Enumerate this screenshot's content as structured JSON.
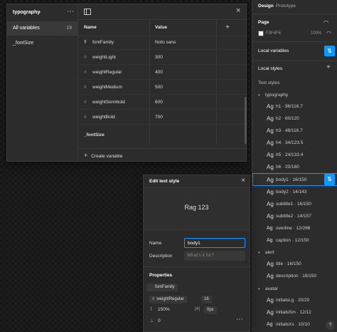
{
  "variables_modal": {
    "collection_title": "typography",
    "sidebar_items": [
      {
        "label": "All variables",
        "count": "19"
      },
      {
        "label": "_fontSize",
        "count": ""
      }
    ],
    "columns": {
      "name": "Name",
      "value": "Value"
    },
    "rows": [
      {
        "name": "fontFamily",
        "value": "Noto sans",
        "icon": "text-icon"
      },
      {
        "name": "weightLight",
        "value": "300",
        "icon": "number-icon"
      },
      {
        "name": "weightRegular",
        "value": "400",
        "icon": "number-icon"
      },
      {
        "name": "weightMedium",
        "value": "500",
        "icon": "number-icon"
      },
      {
        "name": "weightSemibold",
        "value": "600",
        "icon": "number-icon"
      },
      {
        "name": "weightBold",
        "value": "700",
        "icon": "number-icon"
      }
    ],
    "group_label": "_fontSize",
    "create_label": "Create variable"
  },
  "right_panel": {
    "tabs": [
      "Design",
      "Prototype"
    ],
    "page_section": "Page",
    "page_color": "F3F4F6",
    "page_opacity": "100%",
    "local_variables": "Local variables",
    "local_styles": "Local styles",
    "text_styles": "Text styles",
    "groups": {
      "typography": "typography",
      "alert": "alert",
      "avatar": "avatar"
    },
    "typography_styles": [
      {
        "ag": "Ag",
        "name": "h1",
        "spec": " · 96/116.7"
      },
      {
        "ag": "Ag",
        "name": "h2",
        "spec": " · 60/120"
      },
      {
        "ag": "Ag",
        "name": "h3",
        "spec": " · 48/116.7"
      },
      {
        "ag": "Ag",
        "name": "h4",
        "spec": " · 34/123.5"
      },
      {
        "ag": "Ag",
        "name": "h5",
        "spec": " · 24/133.4"
      },
      {
        "ag": "Ag",
        "name": "h6",
        "spec": " · 20/160"
      },
      {
        "ag": "Ag",
        "name": "body1",
        "spec": " · 16/150"
      },
      {
        "ag": "Ag",
        "name": "body2",
        "spec": " · 14/143"
      },
      {
        "ag": "Ag",
        "name": "subtitle1",
        "spec": " · 16/150"
      },
      {
        "ag": "Ag",
        "name": "subtitle2",
        "spec": " · 14/157"
      },
      {
        "ag": "Ag",
        "name": "overline",
        "spec": " · 12/266"
      },
      {
        "ag": "Ag",
        "name": "caption",
        "spec": " · 12/150"
      }
    ],
    "alert_styles": [
      {
        "ag": "Ag",
        "name": "title",
        "spec": " · 16/150"
      },
      {
        "ag": "Ag",
        "name": "description",
        "spec": " · 16/150"
      }
    ],
    "avatar_styles": [
      {
        "ag": "Ag",
        "name": "initialsLg",
        "spec": " · 20/20"
      },
      {
        "ag": "Ag",
        "name": "initialsSm",
        "spec": " · 12/12"
      },
      {
        "ag": "Ag",
        "name": "initialsXs",
        "spec": " · 10/10"
      }
    ],
    "help": "?"
  },
  "edit_modal": {
    "title": "Edit text style",
    "preview": "Rag 123",
    "name_label": "Name",
    "name_value": "body1",
    "description_label": "Description",
    "description_placeholder": "What's it for?",
    "properties_label": "Properties",
    "font_family_chip": "fontFamily",
    "font_weight_chip": "weightRegular",
    "font_size": "16",
    "line_height": "150%",
    "letter_spacing_label": "|A|",
    "letter_spacing": "0px",
    "paragraph_spacing": "0"
  },
  "colors": {
    "accent": "#0d99ff",
    "panel": "#2c2c2c"
  }
}
